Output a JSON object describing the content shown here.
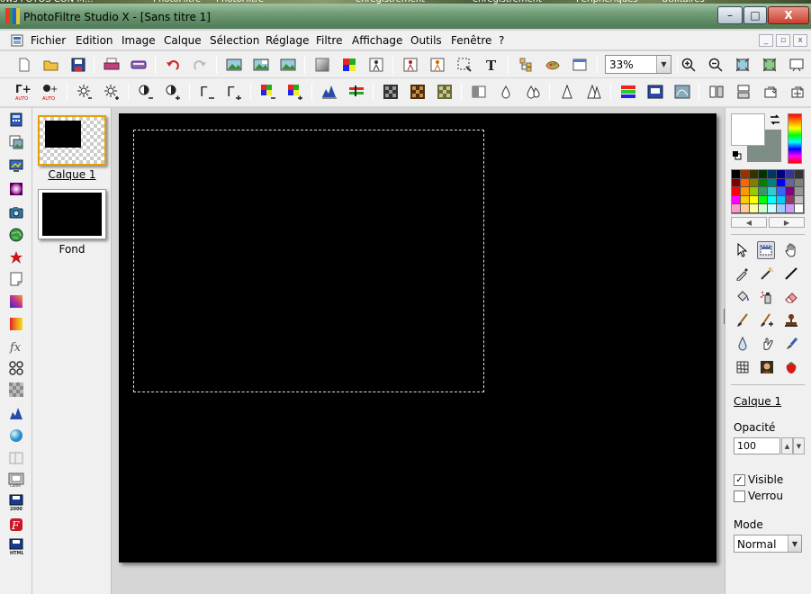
{
  "desktop": {
    "labels": [
      "ows FOTOS CON M...",
      "PhotoFiltre",
      "PhotoFiltre",
      "enregistrement",
      "enregistrement",
      "Périphériques",
      "Utilitaires"
    ]
  },
  "window": {
    "title": "PhotoFiltre Studio X - [Sans titre 1]",
    "minimize": "–",
    "maximize": "□",
    "close": "X"
  },
  "menu": {
    "items": [
      "Fichier",
      "Edition",
      "Image",
      "Calque",
      "Sélection",
      "Réglage",
      "Filtre",
      "Affichage",
      "Outils",
      "Fenêtre",
      "?"
    ],
    "mdi_buttons": [
      "_",
      "▫",
      "x"
    ]
  },
  "toolbar1": {
    "icons": [
      "new-document-icon",
      "open-folder-icon",
      "save-icon",
      "print-icon",
      "scan-icon",
      "undo-icon",
      "redo-icon",
      "image-import-icon",
      "image-export-icon",
      "image-duplicate-icon",
      "gradient-icon",
      "color-palette-icon",
      "automate-icon",
      "crop-icon",
      "transform-icon",
      "selection-tool-icon",
      "text-icon",
      "layer-manager-icon",
      "plugin-icon",
      "window-icon"
    ],
    "zoom_value": "33%",
    "zoom_icons": [
      "zoom-in-icon",
      "zoom-out-icon",
      "fit-window-icon",
      "actual-size-icon",
      "fullscreen-icon"
    ]
  },
  "toolbar2": {
    "icons": [
      "auto-levels-icon",
      "auto-contrast-icon",
      "brightness-minus-icon",
      "brightness-plus-icon",
      "contrast-minus-icon",
      "contrast-plus-icon",
      "gamma-minus-icon",
      "gamma-plus-icon",
      "saturation-minus-icon",
      "saturation-plus-icon",
      "histogram-icon",
      "color-balance-icon",
      "dither-black-icon",
      "dither-brown-icon",
      "dither-olive-icon",
      "blur-icon",
      "sharpen-icon",
      "sharpen-more-icon",
      "soften-icon",
      "soften-more-icon",
      "rgb-levels-icon",
      "color-replace-icon",
      "texture-icon",
      "flip-horizontal-icon",
      "flip-vertical-icon",
      "rotate-icon",
      "rotate-image-icon"
    ]
  },
  "left_strip": {
    "icons": [
      "calculator-icon",
      "image-browser-icon",
      "screen-capture-icon",
      "spotlight-icon",
      "camera-icon",
      "globe-icon",
      "star-icon",
      "note-icon",
      "gradient-diagonal-icon",
      "gradient-icon",
      "fx-icon",
      "mask-icon",
      "pixelate-icon",
      "histogram-icon",
      "sphere-icon",
      "pages-icon",
      "frame-icon",
      "save-2000-icon",
      "script-icon",
      "save-html-icon"
    ]
  },
  "layers": {
    "items": [
      {
        "name": "Calque 1",
        "selected": true
      },
      {
        "name": "Fond",
        "selected": false
      }
    ]
  },
  "canvas": {
    "background": "#000000"
  },
  "colors": {
    "foreground": "#ffffff",
    "background": "#7e8e84",
    "palette": [
      "#000000",
      "#993300",
      "#333300",
      "#003300",
      "#003366",
      "#000080",
      "#333399",
      "#333333",
      "#800000",
      "#ff6600",
      "#808000",
      "#008000",
      "#008080",
      "#0000ff",
      "#666699",
      "#808080",
      "#ff0000",
      "#ff9900",
      "#99cc00",
      "#339966",
      "#33cccc",
      "#3366ff",
      "#800080",
      "#969696",
      "#ff00ff",
      "#ffcc00",
      "#ffff00",
      "#00ff00",
      "#00ffff",
      "#00ccff",
      "#993366",
      "#c0c0c0",
      "#ff99cc",
      "#ffcc99",
      "#ffff99",
      "#ccffcc",
      "#ccffff",
      "#99ccff",
      "#cc99ff",
      "#ffffff"
    ]
  },
  "tools": {
    "icons": [
      "pointer-icon",
      "selection-box-icon",
      "hand-icon",
      "eyedropper-icon",
      "magic-wand-icon",
      "line-icon",
      "paint-bucket-icon",
      "spray-icon",
      "eraser-icon",
      "brush-icon",
      "advanced-brush-icon",
      "stamp-icon",
      "drop-blur-icon",
      "smudge-icon",
      "clone-brush-icon",
      "grid-deform-icon",
      "portrait-icon",
      "strawberry-icon"
    ]
  },
  "properties": {
    "layer_name": "Calque 1",
    "opacity_label": "Opacité",
    "opacity_value": "100",
    "visible_label": "Visible",
    "visible_checked": true,
    "lock_label": "Verrou",
    "lock_checked": false,
    "mode_label": "Mode",
    "mode_value": "Normal"
  }
}
